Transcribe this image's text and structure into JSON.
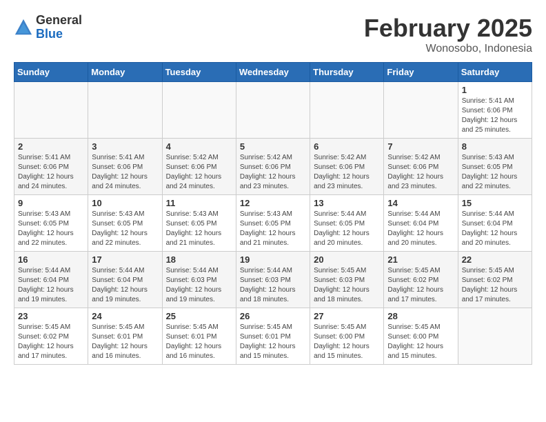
{
  "logo": {
    "general": "General",
    "blue": "Blue"
  },
  "header": {
    "month": "February 2025",
    "location": "Wonosobo, Indonesia"
  },
  "weekdays": [
    "Sunday",
    "Monday",
    "Tuesday",
    "Wednesday",
    "Thursday",
    "Friday",
    "Saturday"
  ],
  "weeks": [
    [
      {
        "day": "",
        "info": ""
      },
      {
        "day": "",
        "info": ""
      },
      {
        "day": "",
        "info": ""
      },
      {
        "day": "",
        "info": ""
      },
      {
        "day": "",
        "info": ""
      },
      {
        "day": "",
        "info": ""
      },
      {
        "day": "1",
        "info": "Sunrise: 5:41 AM\nSunset: 6:06 PM\nDaylight: 12 hours\nand 25 minutes."
      }
    ],
    [
      {
        "day": "2",
        "info": "Sunrise: 5:41 AM\nSunset: 6:06 PM\nDaylight: 12 hours\nand 24 minutes."
      },
      {
        "day": "3",
        "info": "Sunrise: 5:41 AM\nSunset: 6:06 PM\nDaylight: 12 hours\nand 24 minutes."
      },
      {
        "day": "4",
        "info": "Sunrise: 5:42 AM\nSunset: 6:06 PM\nDaylight: 12 hours\nand 24 minutes."
      },
      {
        "day": "5",
        "info": "Sunrise: 5:42 AM\nSunset: 6:06 PM\nDaylight: 12 hours\nand 23 minutes."
      },
      {
        "day": "6",
        "info": "Sunrise: 5:42 AM\nSunset: 6:06 PM\nDaylight: 12 hours\nand 23 minutes."
      },
      {
        "day": "7",
        "info": "Sunrise: 5:42 AM\nSunset: 6:06 PM\nDaylight: 12 hours\nand 23 minutes."
      },
      {
        "day": "8",
        "info": "Sunrise: 5:43 AM\nSunset: 6:05 PM\nDaylight: 12 hours\nand 22 minutes."
      }
    ],
    [
      {
        "day": "9",
        "info": "Sunrise: 5:43 AM\nSunset: 6:05 PM\nDaylight: 12 hours\nand 22 minutes."
      },
      {
        "day": "10",
        "info": "Sunrise: 5:43 AM\nSunset: 6:05 PM\nDaylight: 12 hours\nand 22 minutes."
      },
      {
        "day": "11",
        "info": "Sunrise: 5:43 AM\nSunset: 6:05 PM\nDaylight: 12 hours\nand 21 minutes."
      },
      {
        "day": "12",
        "info": "Sunrise: 5:43 AM\nSunset: 6:05 PM\nDaylight: 12 hours\nand 21 minutes."
      },
      {
        "day": "13",
        "info": "Sunrise: 5:44 AM\nSunset: 6:05 PM\nDaylight: 12 hours\nand 20 minutes."
      },
      {
        "day": "14",
        "info": "Sunrise: 5:44 AM\nSunset: 6:04 PM\nDaylight: 12 hours\nand 20 minutes."
      },
      {
        "day": "15",
        "info": "Sunrise: 5:44 AM\nSunset: 6:04 PM\nDaylight: 12 hours\nand 20 minutes."
      }
    ],
    [
      {
        "day": "16",
        "info": "Sunrise: 5:44 AM\nSunset: 6:04 PM\nDaylight: 12 hours\nand 19 minutes."
      },
      {
        "day": "17",
        "info": "Sunrise: 5:44 AM\nSunset: 6:04 PM\nDaylight: 12 hours\nand 19 minutes."
      },
      {
        "day": "18",
        "info": "Sunrise: 5:44 AM\nSunset: 6:03 PM\nDaylight: 12 hours\nand 19 minutes."
      },
      {
        "day": "19",
        "info": "Sunrise: 5:44 AM\nSunset: 6:03 PM\nDaylight: 12 hours\nand 18 minutes."
      },
      {
        "day": "20",
        "info": "Sunrise: 5:45 AM\nSunset: 6:03 PM\nDaylight: 12 hours\nand 18 minutes."
      },
      {
        "day": "21",
        "info": "Sunrise: 5:45 AM\nSunset: 6:02 PM\nDaylight: 12 hours\nand 17 minutes."
      },
      {
        "day": "22",
        "info": "Sunrise: 5:45 AM\nSunset: 6:02 PM\nDaylight: 12 hours\nand 17 minutes."
      }
    ],
    [
      {
        "day": "23",
        "info": "Sunrise: 5:45 AM\nSunset: 6:02 PM\nDaylight: 12 hours\nand 17 minutes."
      },
      {
        "day": "24",
        "info": "Sunrise: 5:45 AM\nSunset: 6:01 PM\nDaylight: 12 hours\nand 16 minutes."
      },
      {
        "day": "25",
        "info": "Sunrise: 5:45 AM\nSunset: 6:01 PM\nDaylight: 12 hours\nand 16 minutes."
      },
      {
        "day": "26",
        "info": "Sunrise: 5:45 AM\nSunset: 6:01 PM\nDaylight: 12 hours\nand 15 minutes."
      },
      {
        "day": "27",
        "info": "Sunrise: 5:45 AM\nSunset: 6:00 PM\nDaylight: 12 hours\nand 15 minutes."
      },
      {
        "day": "28",
        "info": "Sunrise: 5:45 AM\nSunset: 6:00 PM\nDaylight: 12 hours\nand 15 minutes."
      },
      {
        "day": "",
        "info": ""
      }
    ]
  ]
}
